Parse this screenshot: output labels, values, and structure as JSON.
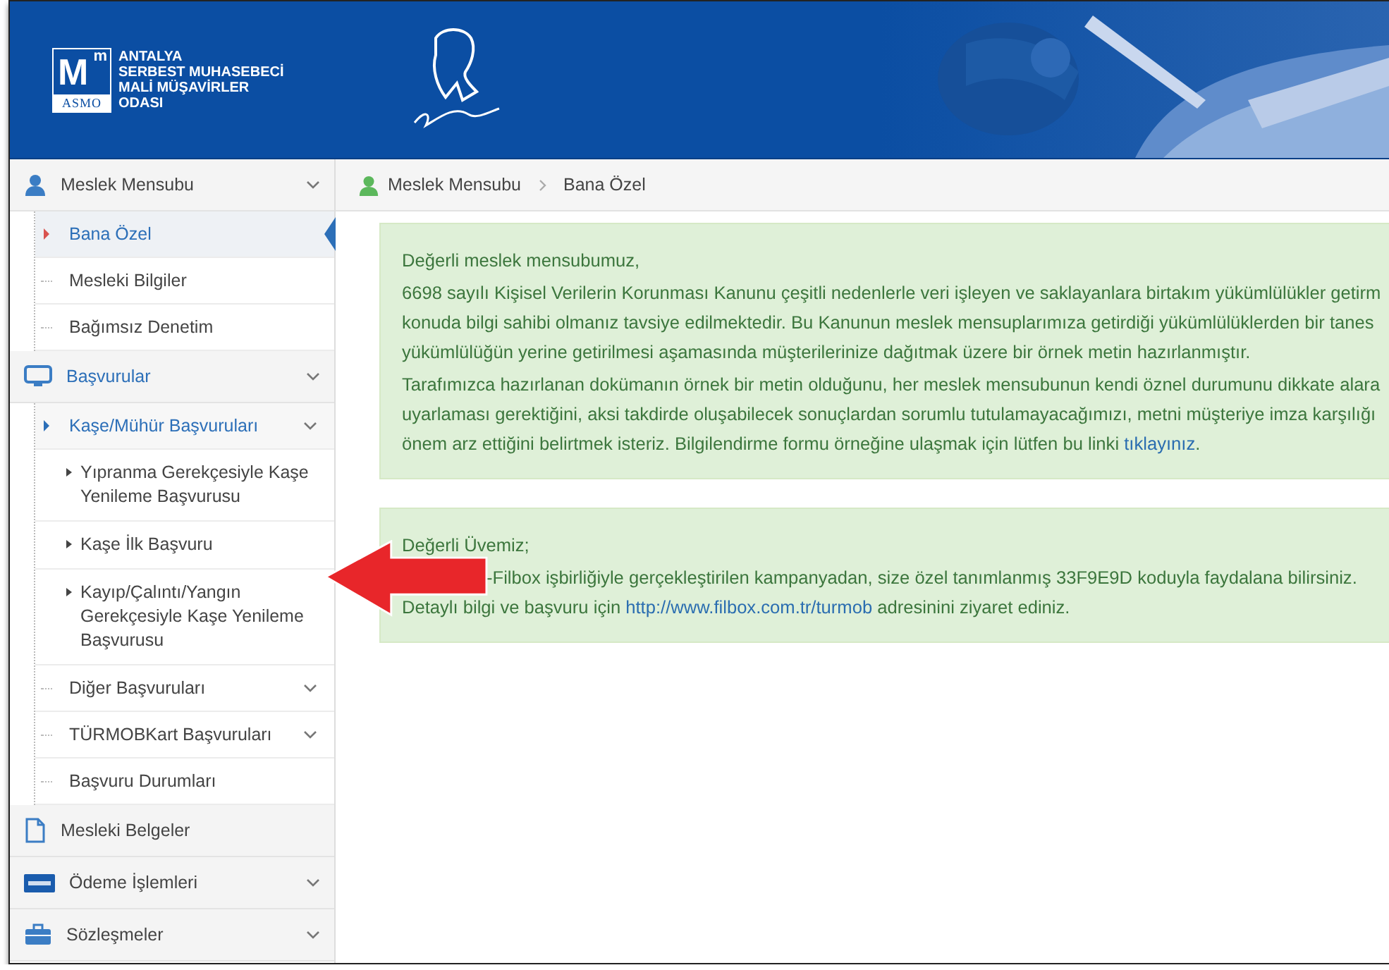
{
  "header": {
    "logo": {
      "letter": "M",
      "superscript": "m",
      "caption": "ASMO"
    },
    "org_name": [
      "ANTALYA",
      "SERBEST MUHASEBECİ",
      "MALİ MÜŞAVİRLER",
      "ODASI"
    ]
  },
  "sidebar": {
    "items": [
      {
        "label": "Meslek Mensubu",
        "active": false,
        "submenu": true,
        "children": [
          {
            "label": "Bana Özel",
            "selected": true,
            "active": false
          },
          {
            "label": "Mesleki Bilgiler",
            "selected": false,
            "active": false
          },
          {
            "label": "Bağımsız Denetim",
            "selected": false,
            "active": false
          }
        ]
      },
      {
        "label": "Başvurular",
        "active": true,
        "submenu": true,
        "children": [
          {
            "label": "Kaşe/Mühür Başvuruları",
            "selected": false,
            "active": true,
            "submenu": true,
            "children": [
              {
                "label": "Yıpranma Gerekçesiyle Kaşe Yenileme Başvurusu",
                "selected": false
              },
              {
                "label": "Kaşe İlk Başvuru",
                "selected": false
              },
              {
                "label": "Kayıp/Çalıntı/Yangın Gerekçesiyle Kaşe Yenileme Başvurusu",
                "selected": false
              }
            ]
          },
          {
            "label": "Diğer Başvuruları",
            "selected": false,
            "active": false,
            "submenu": true
          },
          {
            "label": "TÜRMOBKart Başvuruları",
            "selected": false,
            "active": false,
            "submenu": true
          },
          {
            "label": "Başvuru Durumları",
            "selected": false,
            "active": false
          }
        ]
      },
      {
        "label": "Mesleki Belgeler",
        "active": false,
        "submenu": false
      },
      {
        "label": "Ödeme İşlemleri",
        "active": false,
        "submenu": true
      },
      {
        "label": "Sözleşmeler",
        "active": false,
        "submenu": true
      }
    ]
  },
  "breadcrumb": [
    "Meslek Mensubu",
    "Bana Özel"
  ],
  "notices": [
    {
      "greeting": "Değerli meslek mensubumuz,",
      "paragraphs": [
        {
          "lines": [
            [
              {
                "text": "6698 sayılı Kişisel Verilerin Korunması Kanunu çeşitli nedenlerle veri işleyen ve saklayanlara birtakım yükümlülükler getirm"
              }
            ],
            [
              {
                "text": "konuda bilgi sahibi olmanız tavsiye edilmektedir. Bu Kanunun meslek mensuplarımıza getirdiği yükümlülüklerden bir tanes"
              }
            ],
            [
              {
                "text": "yükümlülüğün yerine getirilmesi aşamasında müşterilerinize dağıtmak üzere bir örnek metin hazırlanmıştır."
              }
            ]
          ]
        },
        {
          "lines": [
            [
              {
                "text": "Tarafımızca hazırlanan dokümanın örnek bir metin olduğunu, her meslek mensubunun kendi öznel durumunu dikkate alara"
              }
            ],
            [
              {
                "text": "uyarlaması gerektiğini, aksi takdirde oluşabilecek sonuçlardan sorumlu tutulamayacağımızı, metni müşteriye imza karşılığı"
              }
            ],
            [
              {
                "text": "önem arz ettiğini belirtmek isteriz. Bilgilendirme formu örneğine ulaşmak için lütfen bu linki "
              },
              {
                "text": "tıklayınız",
                "kind": "link"
              },
              {
                "text": "."
              }
            ]
          ]
        }
      ]
    },
    {
      "greeting": "Değerli Üvemiz;",
      "paragraphs": [
        {
          "lines": [
            [
              {
                "text": "-Filbox işbirliğiyle gerçekleştirilen kampanyadan, size özel tanımlanmış 33F9E9D koduyla faydalana bilirsiniz.",
                "covered_start": true
              }
            ],
            [
              {
                "text": "Detaylı bilgi ve başvuru için "
              },
              {
                "text": "http://www.filbox.com.tr/turmob",
                "kind": "link"
              },
              {
                "text": " adresinini ziyaret ediniz."
              }
            ]
          ]
        }
      ]
    }
  ]
}
